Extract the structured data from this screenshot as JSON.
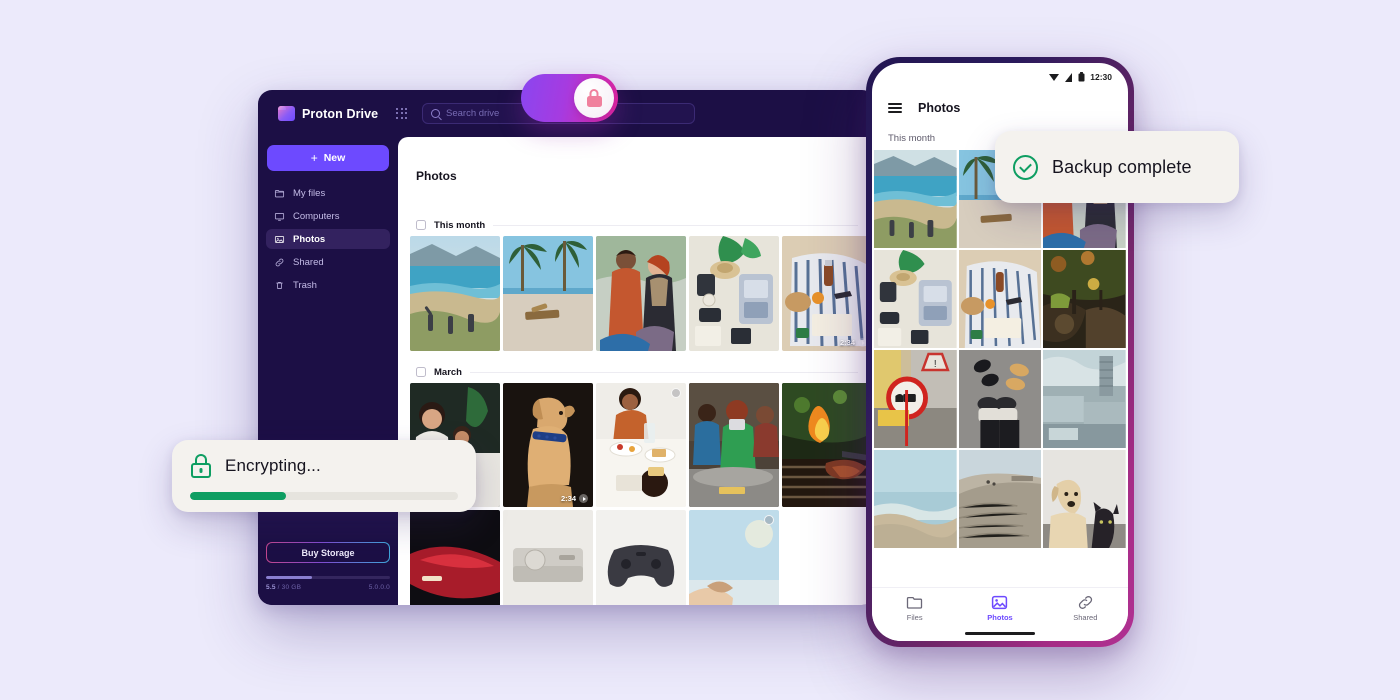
{
  "background_color": "#ECEAFB",
  "desktop": {
    "brand_name": "Proton Drive",
    "apps_grid_icon": "apps-grid-icon",
    "search": {
      "placeholder": "Search drive",
      "value": ""
    },
    "new_button_label": "New",
    "nav_items": [
      {
        "label": "My files",
        "icon": "folder-icon",
        "active": false
      },
      {
        "label": "Computers",
        "icon": "monitor-icon",
        "active": false
      },
      {
        "label": "Photos",
        "icon": "image-icon",
        "active": true
      },
      {
        "label": "Shared",
        "icon": "link-icon",
        "active": false
      },
      {
        "label": "Trash",
        "icon": "trash-icon",
        "active": false
      }
    ],
    "buy_storage_label": "Buy Storage",
    "storage": {
      "used": "5.5",
      "separator": " / ",
      "total": "30 GB",
      "version": "5.0.0.0",
      "percent": 37
    },
    "page_title": "Photos",
    "sections": [
      {
        "label": "This month",
        "photos": [
          {
            "name": "coastal-hike",
            "video": false
          },
          {
            "name": "palm-beach",
            "video": false
          },
          {
            "name": "couple-outdoor",
            "video": false
          },
          {
            "name": "packed-suitcase",
            "video": false
          },
          {
            "name": "beach-picnic",
            "video": true,
            "duration": "2:34"
          }
        ]
      },
      {
        "label": "March",
        "photos": [
          {
            "name": "family-kitchen",
            "video": false
          },
          {
            "name": "dog-portrait",
            "video": true,
            "duration": "2:34"
          },
          {
            "name": "brunch-table",
            "video": false,
            "selected": true
          },
          {
            "name": "friends-phone",
            "video": false
          },
          {
            "name": "bbq-grill",
            "video": false
          }
        ]
      },
      {
        "label": "",
        "photos": [
          {
            "name": "red-car",
            "video": false
          },
          {
            "name": "game-console",
            "video": false
          },
          {
            "name": "game-controller",
            "video": false
          },
          {
            "name": "sunny-window",
            "video": false,
            "selected": true
          }
        ]
      }
    ]
  },
  "lock_toggle": {
    "state": "on",
    "icon": "lock-icon",
    "accent_from": "#8A46F0",
    "accent_to": "#E0239C"
  },
  "phone": {
    "status_bar": {
      "time": "12:30",
      "icons": [
        "wifi-icon",
        "signal-icon",
        "battery-icon"
      ]
    },
    "menu_icon": "hamburger-menu-icon",
    "title": "Photos",
    "section_label": "This month",
    "grid": [
      {
        "name": "coastal-hike"
      },
      {
        "name": "palm-beach"
      },
      {
        "name": "couple-outdoor"
      },
      {
        "name": "packed-suitcase"
      },
      {
        "name": "beach-picnic"
      },
      {
        "name": "forest-camp"
      },
      {
        "name": "street-sign"
      },
      {
        "name": "shoes-pavement"
      },
      {
        "name": "city-skyline"
      },
      {
        "name": "sea-shore"
      },
      {
        "name": "sand-dune"
      },
      {
        "name": "dog-and-cat"
      }
    ],
    "bottom_nav": [
      {
        "label": "Files",
        "icon": "folder-icon",
        "active": false
      },
      {
        "label": "Photos",
        "icon": "image-icon",
        "active": true
      },
      {
        "label": "Shared",
        "icon": "link-icon",
        "active": false
      }
    ]
  },
  "toasts": {
    "encrypting": {
      "text": "Encrypting...",
      "icon": "lock-icon",
      "progress_percent": 36,
      "accent": "#0E9E62"
    },
    "backup": {
      "text": "Backup complete",
      "icon": "check-circle-icon",
      "accent": "#0E9E62"
    }
  }
}
